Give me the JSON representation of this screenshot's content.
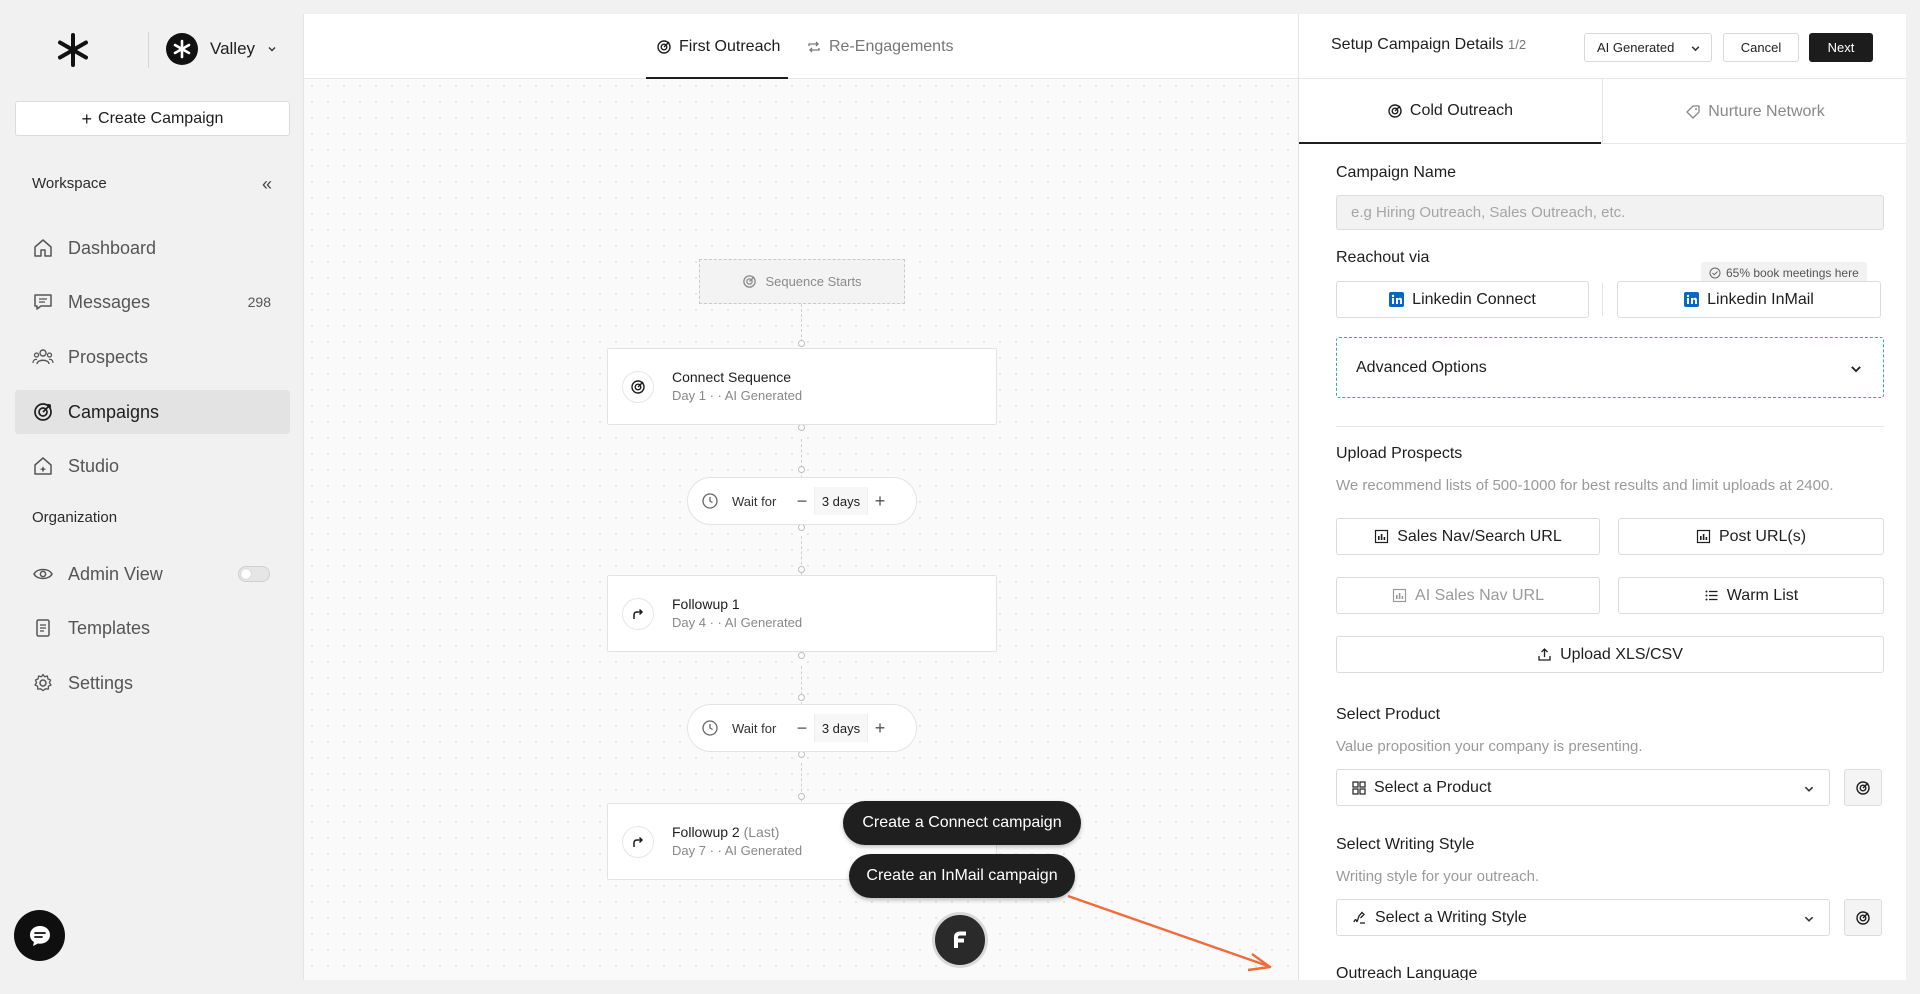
{
  "sidebar": {
    "workspace_name": "Valley",
    "create_label": "Create Campaign",
    "workspace_section": "Workspace",
    "organization_section": "Organization",
    "nav": [
      {
        "label": "Dashboard",
        "icon": "home-icon"
      },
      {
        "label": "Messages",
        "icon": "message-icon",
        "count": "298"
      },
      {
        "label": "Prospects",
        "icon": "people-icon"
      },
      {
        "label": "Campaigns",
        "icon": "target-icon",
        "active": true
      },
      {
        "label": "Studio",
        "icon": "studio-icon"
      }
    ],
    "org_nav": [
      {
        "label": "Admin View",
        "icon": "eye-icon",
        "toggle": false
      },
      {
        "label": "Templates",
        "icon": "document-icon"
      },
      {
        "label": "Settings",
        "icon": "gear-icon"
      }
    ]
  },
  "canvas": {
    "tabs": [
      {
        "label": "First Outreach",
        "active": true
      },
      {
        "label": "Re-Engagements",
        "active": false
      }
    ],
    "sequence_start": "Sequence Starts",
    "steps": [
      {
        "title": "Connect Sequence",
        "subtitle": "Day 1 · · AI Generated"
      },
      {
        "title": "Followup 1",
        "subtitle": "Day 4 · · AI Generated"
      },
      {
        "title": "Followup 2",
        "title_suffix": "(Last)",
        "subtitle": "Day 7 · · AI Generated"
      }
    ],
    "waits": [
      {
        "label": "Wait for",
        "value": "3 days"
      },
      {
        "label": "Wait for",
        "value": "3 days"
      }
    ],
    "pills": {
      "connect": "Create a Connect campaign",
      "inmail": "Create an InMail campaign"
    }
  },
  "panel": {
    "title": "Setup Campaign Details",
    "page": "1/2",
    "mode_select": "AI Generated",
    "cancel_label": "Cancel",
    "next_label": "Next",
    "tabs": [
      {
        "label": "Cold Outreach",
        "active": true
      },
      {
        "label": "Nurture Network",
        "active": false
      }
    ],
    "campaign_name": {
      "label": "Campaign Name",
      "value": "",
      "placeholder": "e.g Hiring Outreach, Sales Outreach, etc."
    },
    "reachout": {
      "label": "Reachout via",
      "badge": "65% book meetings here",
      "connect_label": "Linkedin Connect",
      "inmail_label": "Linkedin InMail"
    },
    "advanced_label": "Advanced Options",
    "upload": {
      "label": "Upload Prospects",
      "hint": "We recommend lists of 500-1000 for best results and limit uploads at 2400.",
      "sales_nav": "Sales Nav/Search URL",
      "post_urls": "Post URL(s)",
      "ai_sales_nav": "AI Sales Nav URL",
      "warm_list": "Warm List",
      "upload_file": "Upload XLS/CSV"
    },
    "product": {
      "label": "Select Product",
      "hint": "Value proposition your company is presenting.",
      "value": "Select a Product"
    },
    "writing_style": {
      "label": "Select Writing Style",
      "hint": "Writing style for your outreach.",
      "value": "Select a Writing Style"
    },
    "language_label": "Outreach Language"
  },
  "colors": {
    "accent_dark": "#1c1c1c",
    "linkedin_blue": "#0a66c2",
    "advanced_border": "#3ba5b0",
    "annotation_arrow": "#f2693b"
  }
}
